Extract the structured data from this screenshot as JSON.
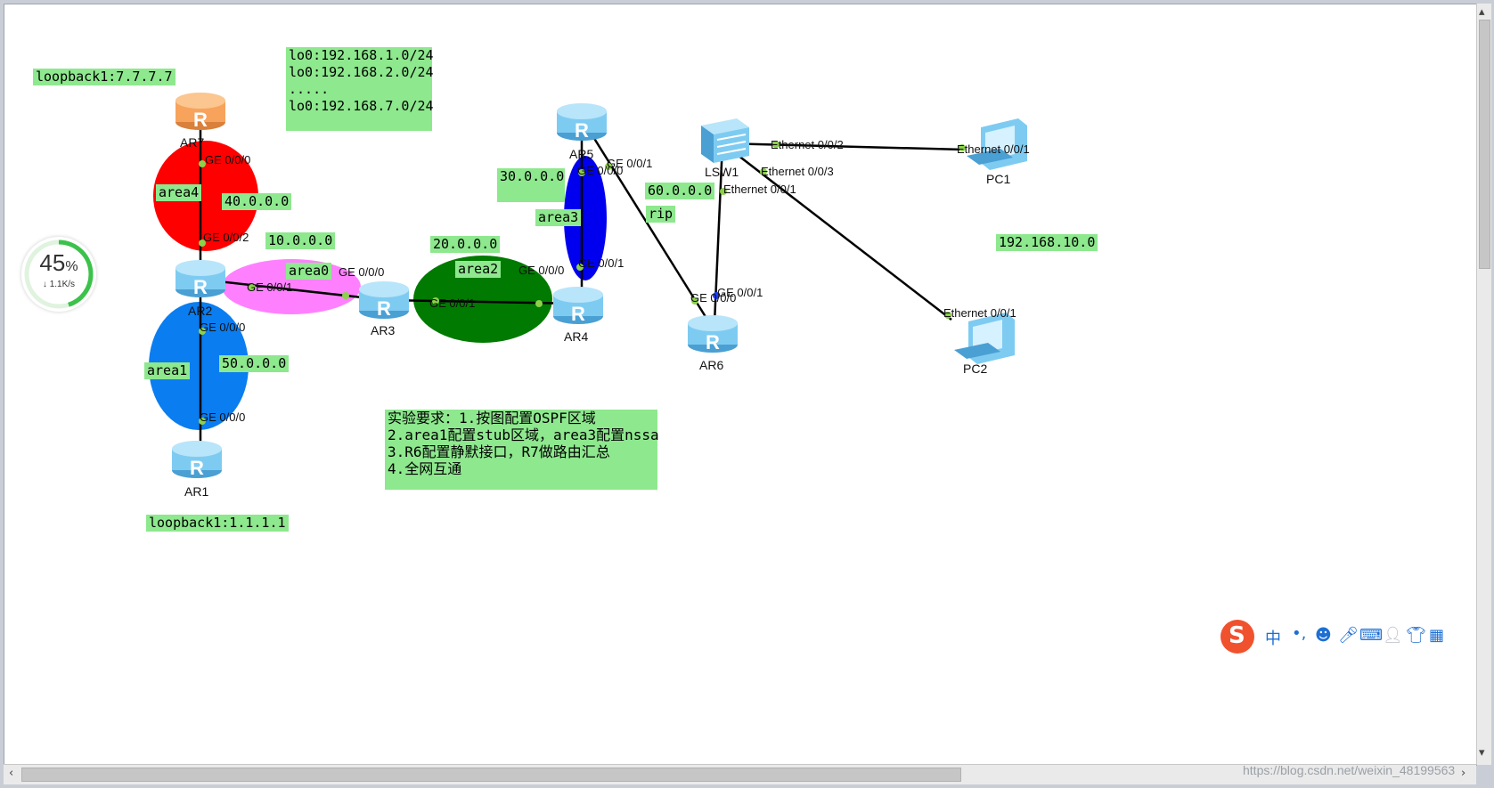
{
  "notes": {
    "loopback7": "loopback1:7.7.7.7",
    "loopback1": "loopback1:1.1.1.1",
    "lo_list": "lo0:192.168.1.0/24\nlo0:192.168.2.0/24\n.....\nlo0:192.168.7.0/24",
    "net_40": "40.0.0.0",
    "net_10": "10.0.0.0",
    "net_20": "20.0.0.0",
    "net_30": "30.0.0.0",
    "net_50": "50.0.0.0",
    "net_60": "60.0.0.0",
    "rip": "rip",
    "net_192": "192.168.10.0",
    "area4": "area4",
    "area0": "area0",
    "area2": "area2",
    "area3": "area3",
    "area1": "area1",
    "requirements": "实验要求：1.按图配置OSPF区域\n2.area1配置stub区域，area3配置nssa\n3.R6配置静默接口，R7做路由汇总\n4.全网互通"
  },
  "devices": {
    "ar7": "AR7",
    "ar2": "AR2",
    "ar1": "AR1",
    "ar3": "AR3",
    "ar4": "AR4",
    "ar5": "AR5",
    "ar6": "AR6",
    "lsw1": "LSW1",
    "pc1": "PC1",
    "pc2": "PC2"
  },
  "ports": {
    "ar7_ge000": "GE 0/0/0",
    "ar2_ge002": "GE 0/0/2",
    "ar2_ge001": "GE 0/0/1",
    "ar3_ge000": "GE 0/0/0",
    "ar3_ge001": "GE 0/0/1",
    "ar4_ge000": "GE 0/0/0",
    "ar4_ge001": "GE 0/0/1",
    "ar5_ge000": "GE 0/0/0",
    "ar5_ge001": "GE 0/0/1",
    "ar2_ge000": "GE 0/0/0",
    "ar1_ge000": "GE 0/0/0",
    "ar6_ge000": "GE 0/0/0",
    "ar6_ge001": "GE 0/0/1",
    "lsw_e001": "Ethernet 0/0/1",
    "lsw_e002": "Ethernet 0/0/2",
    "lsw_e003": "Ethernet 0/0/3",
    "pc1_e001": "Ethernet 0/0/1",
    "pc2_e001": "Ethernet 0/0/1"
  },
  "colors": {
    "note_bg": "#8ee88e",
    "area4": "#ff0000",
    "area0": "#ff80ff",
    "area2": "#007a00",
    "area3": "#0000ee",
    "area1": "#0a7df0",
    "router": "#7ecbf2",
    "router_ar7": "#f7a35c"
  },
  "speed_widget": {
    "percent": "45",
    "percent_sign": "%",
    "rate": "↓ 1.1K/s",
    "level": 0.45
  },
  "ime": {
    "chinese": "中",
    "punct": "•,"
  },
  "watermark": "https://blog.csdn.net/weixin_48199563"
}
